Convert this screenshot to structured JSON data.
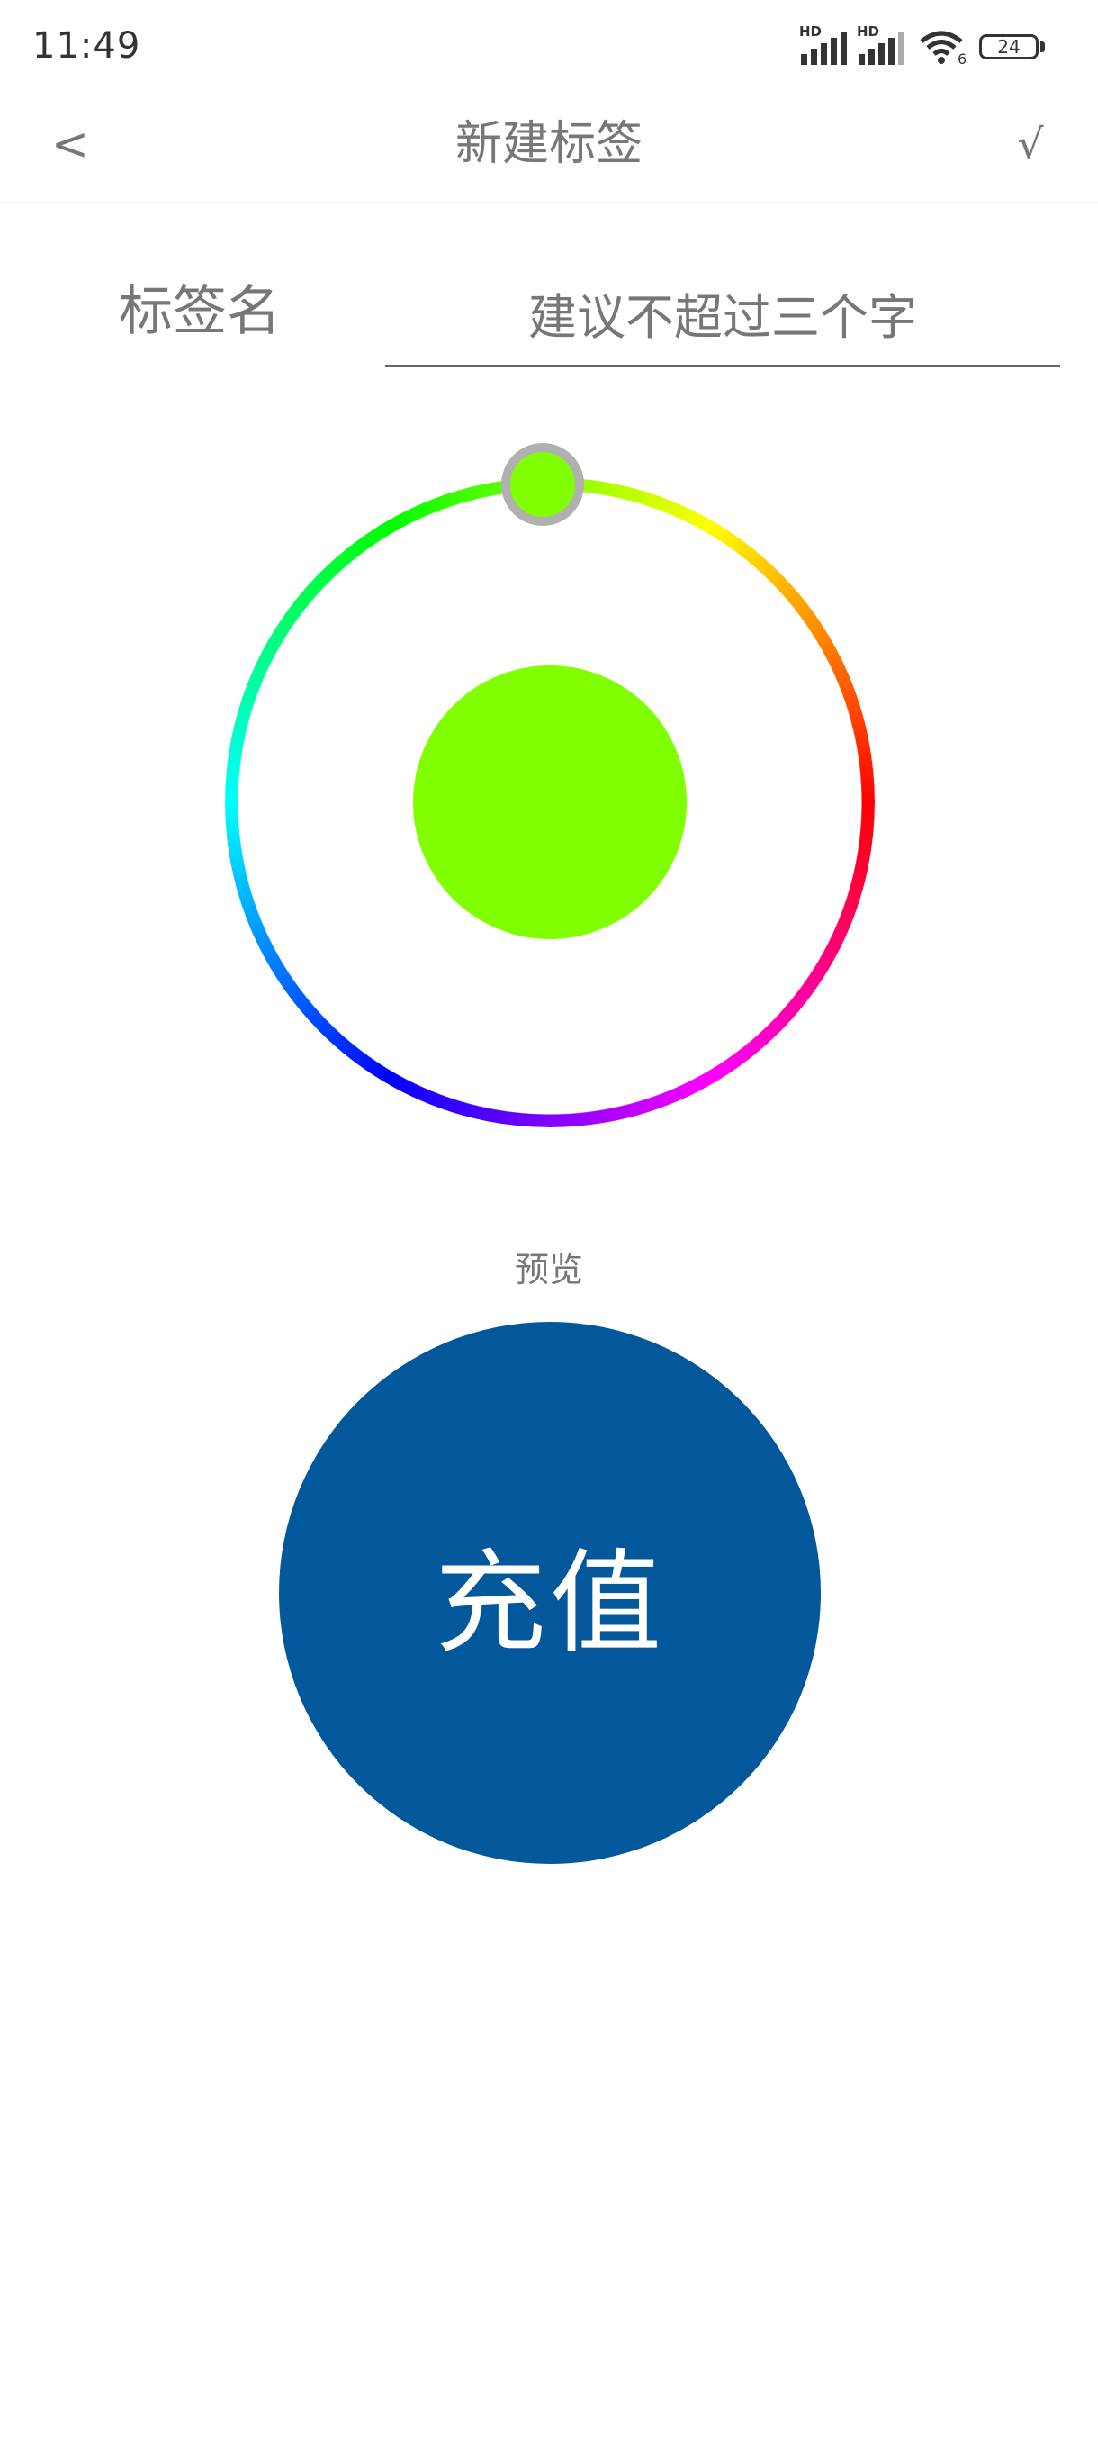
{
  "status_bar": {
    "time": "11:49",
    "signal_1_label": "HD",
    "signal_2_label": "HD",
    "wifi_label": "6",
    "battery": "24"
  },
  "nav": {
    "back_label": "<",
    "title": "新建标签",
    "confirm_label": "√"
  },
  "name_field": {
    "label": "标签名",
    "placeholder": "建议不超过三个字",
    "value": ""
  },
  "color_picker": {
    "selected_color": "#80ff00",
    "hue_degrees": 90
  },
  "preview": {
    "label": "预览",
    "text": "充值",
    "background_color": "#03579b"
  },
  "colors": {
    "text_gray": "#777777",
    "ring_thumb_border": "#b0b0b0"
  }
}
